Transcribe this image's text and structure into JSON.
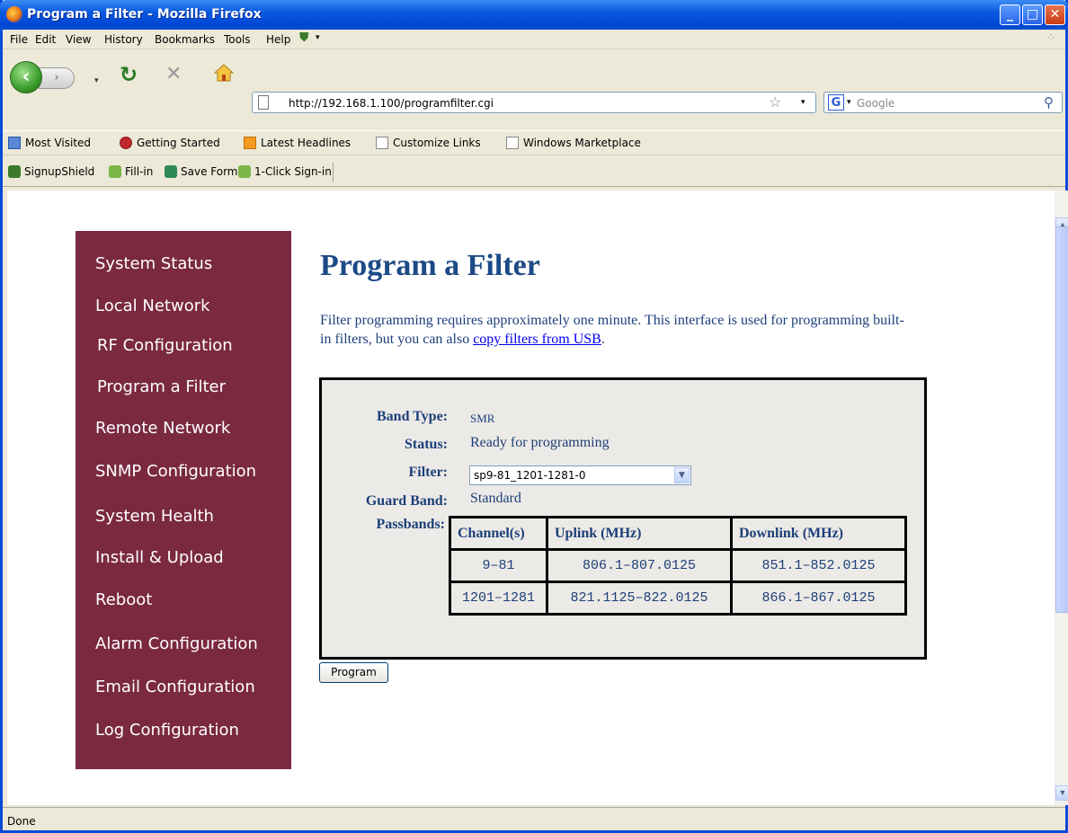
{
  "window": {
    "title": "Program a Filter - Mozilla Firefox"
  },
  "menu": [
    "File",
    "Edit",
    "View",
    "History",
    "Bookmarks",
    "Tools",
    "Help"
  ],
  "address": {
    "url": "http://192.168.1.100/programfilter.cgi"
  },
  "search": {
    "placeholder": "Google"
  },
  "bookmarks": [
    "Most Visited",
    "Getting Started",
    "Latest Headlines",
    "Customize Links",
    "Windows Marketplace"
  ],
  "toolbar2": [
    "SignupShield",
    "Fill-in",
    "Save Form",
    "1-Click Sign-in"
  ],
  "sidebar": {
    "items": [
      "System Status",
      "Local Network",
      "RF Configuration",
      "Program a Filter",
      "Remote Network",
      "SNMP Configuration",
      "System Health",
      "Install & Upload",
      "Reboot",
      "Alarm Configuration",
      "Email Configuration",
      "Log Configuration"
    ]
  },
  "page": {
    "title": "Program a Filter",
    "intro_text": "Filter programming requires approximately one minute. This interface is used for programming built-in filters, but you can also ",
    "intro_link": "copy filters from USB",
    "intro_end": "."
  },
  "form": {
    "band_type_label": "Band Type:",
    "band_type_value": "SMR",
    "status_label": "Status:",
    "status_value": "Ready for programming",
    "filter_label": "Filter:",
    "filter_value": "sp9-81_1201-1281-0",
    "guard_band_label": "Guard Band:",
    "guard_band_value": "Standard",
    "passbands_label": "Passbands:",
    "table": {
      "headers": [
        "Channel(s)",
        "Uplink (MHz)",
        "Downlink (MHz)"
      ],
      "rows": [
        [
          "9–81",
          "806.1–807.0125",
          "851.1–852.0125"
        ],
        [
          "1201–1281",
          "821.1125–822.0125",
          "866.1–867.0125"
        ]
      ]
    },
    "program_button": "Program"
  },
  "status_bar": {
    "text": "Done"
  },
  "colors": {
    "sidebar_bg": "#7a2940",
    "heading": "#1c4a86",
    "body_text": "#1c3f7a",
    "link": "#0000ee"
  }
}
